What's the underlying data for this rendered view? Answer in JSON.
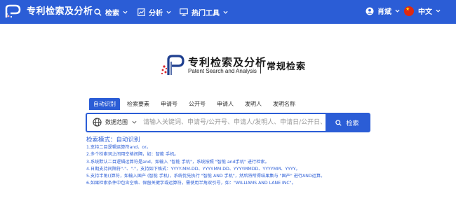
{
  "header": {
    "brand": "专利检索及分析",
    "nav": [
      {
        "label": "检索",
        "icon": "search-icon"
      },
      {
        "label": "分析",
        "icon": "chart-icon"
      },
      {
        "label": "热门工具",
        "icon": "monitor-icon"
      }
    ],
    "user": "肖斌",
    "language": "中文"
  },
  "hero": {
    "title": "专利检索及分析",
    "subtitle": "Patent Search and Analysis",
    "mode": "常规检索"
  },
  "tabs": [
    "自动识别",
    "检索要素",
    "申请号",
    "公开号",
    "申请人",
    "发明人",
    "发明名称"
  ],
  "active_tab": 0,
  "search": {
    "scope_label": "数据范围",
    "placeholder": "请输入关键词、申请号/公开号、申请人/发明人、申请日/公开日、IPC分...",
    "button_label": "检索"
  },
  "mode_line": "检索模式：自动识别",
  "hints": [
    "1.支持二目逻辑运算符and、or。",
    "2.多个检索词之间用空格间隔，如：智能 手机。",
    "3.系统默认二目逻辑运算符是and，如输入 \"智能 手机\"，系统按照 \"智能 and手机\" 进行检索。",
    "4.日期支持间隔符\"-\"、\".\"，支持如下格式：YYYY-MM-DD、YYYY.MM.DD、YYYYMMDD、YYYYMM、YYYY。",
    "5.支持半角()算符，如输入国产 (智能 手机)，系统优先执行 \"智能 AND 手机\"，然后将所得结果集与 \"国产\" 进行AND运算。",
    "6.如果检索条件中包含空格、保留关键字或运算符，需使用半角双引号，如：\"WILLIAMS AND LANE INC\"。"
  ],
  "colors": {
    "primary": "#2b5dd6",
    "flag": "#de2910"
  }
}
